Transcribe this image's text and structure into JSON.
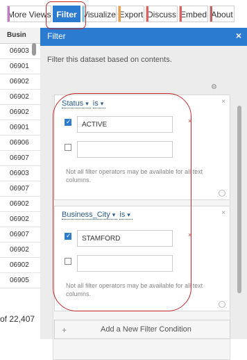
{
  "tabs": [
    {
      "label": "More Views",
      "accent": "#c07cc0"
    },
    {
      "label": "Filter",
      "active": true
    },
    {
      "label": "Visualize",
      "accent": "#7ed0e6"
    },
    {
      "label": "Export",
      "accent": "#f0a040"
    },
    {
      "label": "Discuss",
      "accent": "#e06060"
    },
    {
      "label": "Embed",
      "accent": "#e06060"
    },
    {
      "label": "About",
      "accent": "#c06060"
    }
  ],
  "table": {
    "header": "Busin",
    "rows": [
      "06903",
      "06901",
      "06902",
      "06902",
      "06902",
      "06901",
      "06906",
      "06907",
      "06903",
      "06907",
      "06902",
      "06902",
      "06907",
      "06902",
      "06902",
      "06905"
    ],
    "footer": "of 22,407"
  },
  "panel": {
    "title": "Filter",
    "close": "×",
    "description": "Filter this dataset based on contents."
  },
  "conditions": [
    {
      "column": "Status",
      "operator": "is",
      "values": [
        {
          "checked": true,
          "text": "ACTIVE"
        },
        {
          "checked": false,
          "text": ""
        }
      ],
      "note": "Not all filter operators may be available for all text columns."
    },
    {
      "column": "Business_City",
      "operator": "is",
      "values": [
        {
          "checked": true,
          "text": "STAMFORD"
        },
        {
          "checked": false,
          "text": ""
        }
      ],
      "note": "Not all filter operators may be available for all text columns."
    }
  ],
  "add_condition": {
    "plus": "+",
    "label": "Add a New Filter Condition"
  },
  "icons": {
    "gear": "gear-icon",
    "close": "close-icon",
    "caret": "caret-down-icon"
  },
  "colors": {
    "accent": "#2b7bd1",
    "annotation": "#c62828"
  }
}
